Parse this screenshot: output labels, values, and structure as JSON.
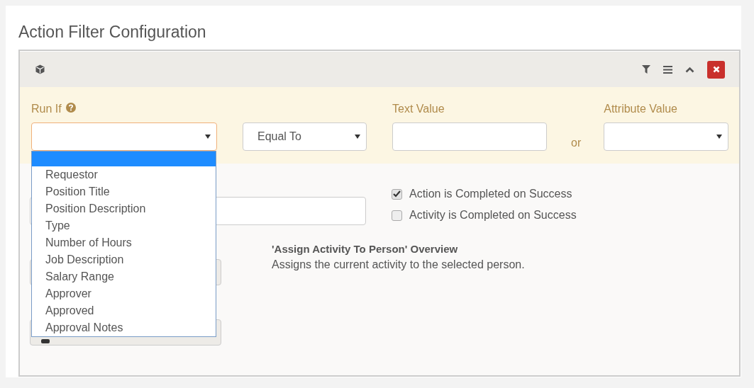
{
  "page_title": "Action Filter Configuration",
  "filter": {
    "run_if": {
      "label": "Run If",
      "open": true,
      "blank_option_highlighted": true,
      "options": [
        "Requestor",
        "Position Title",
        "Position Description",
        "Type",
        "Number of Hours",
        "Job Description",
        "Salary Range",
        "Approver",
        "Approved",
        "Approval Notes"
      ]
    },
    "comparison": {
      "value": "Equal To"
    },
    "text_value": {
      "label": "Text Value"
    },
    "or_text": "or",
    "attribute_value": {
      "label": "Attribute Value"
    }
  },
  "checkboxes": [
    {
      "label": "Action is Completed on Success",
      "checked": true
    },
    {
      "label": "Activity is Completed on Success",
      "checked": false
    }
  ],
  "overview": {
    "title": "'Assign Activity To Person' Overview",
    "text": "Assigns the current activity to the selected person."
  }
}
